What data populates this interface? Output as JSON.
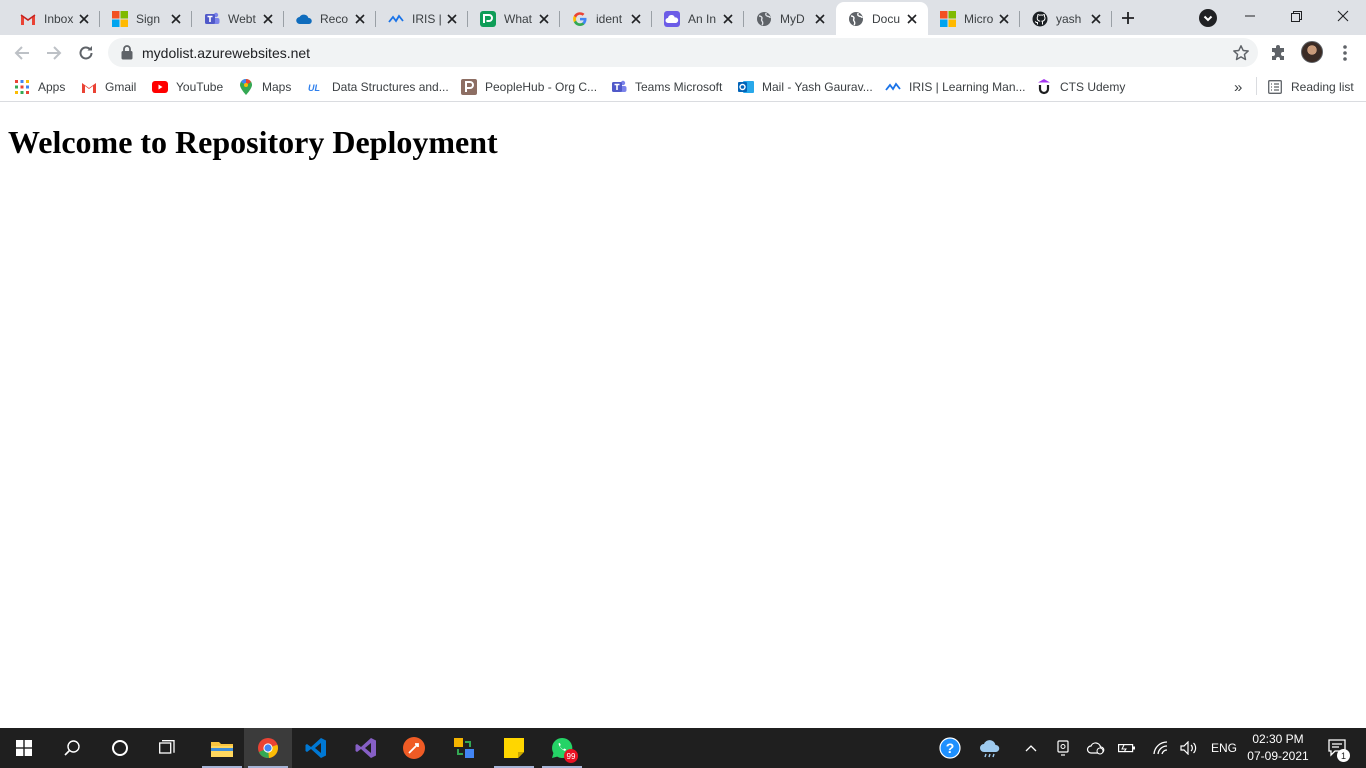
{
  "browser": {
    "tabs": [
      {
        "title": "Inbox",
        "icon": "gmail-icon"
      },
      {
        "title": "Sign",
        "icon": "microsoft-icon"
      },
      {
        "title": "Webt",
        "icon": "teams-icon"
      },
      {
        "title": "Reco",
        "icon": "onedrive-icon"
      },
      {
        "title": "IRIS |",
        "icon": "iris-icon"
      },
      {
        "title": "What",
        "icon": "wa-icon"
      },
      {
        "title": "ident",
        "icon": "google-icon"
      },
      {
        "title": "An In",
        "icon": "cloud-icon"
      },
      {
        "title": "MyD",
        "icon": "globe-icon"
      },
      {
        "title": "Docu",
        "icon": "globe-icon",
        "active": true
      },
      {
        "title": "Micro",
        "icon": "microsoft-icon"
      },
      {
        "title": "yash",
        "icon": "github-icon"
      }
    ],
    "url": "mydolist.azurewebsites.net",
    "bookmarks": [
      {
        "label": "Apps",
        "icon": "apps-grid-icon"
      },
      {
        "label": "Gmail",
        "icon": "gmail-icon"
      },
      {
        "label": "YouTube",
        "icon": "youtube-icon"
      },
      {
        "label": "Maps",
        "icon": "maps-pin-icon"
      },
      {
        "label": "Data Structures and...",
        "icon": "ul-icon"
      },
      {
        "label": "PeopleHub - Org C...",
        "icon": "peoplehub-icon"
      },
      {
        "label": "Teams Microsoft",
        "icon": "teams-icon"
      },
      {
        "label": "Mail - Yash Gaurav...",
        "icon": "outlook-icon"
      },
      {
        "label": "IRIS | Learning Man...",
        "icon": "iris-icon"
      },
      {
        "label": "CTS Udemy",
        "icon": "udemy-icon"
      }
    ],
    "overflow": "»",
    "reading_list": "Reading list"
  },
  "page": {
    "heading": "Welcome to Repository Deployment"
  },
  "taskbar": {
    "clock_time": "02:30 PM",
    "clock_date": "07-09-2021",
    "language": "ENG",
    "whatsapp_badge": "99",
    "notification_count": "1"
  }
}
